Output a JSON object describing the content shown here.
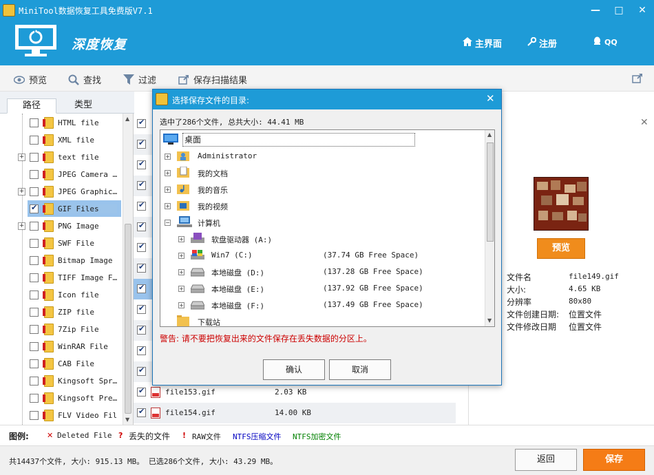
{
  "window": {
    "title": "MiniTool数据恢复工具免费版V7.1",
    "minimize": "—",
    "maximize": "□",
    "close": "✕"
  },
  "header": {
    "app_name": "深度恢复",
    "nav": {
      "home": "主界面",
      "register": "注册",
      "qq": "QQ"
    }
  },
  "toolbar": {
    "preview": "预览",
    "find": "查找",
    "filter": "过滤",
    "save_scan": "保存扫描结果"
  },
  "tabs": {
    "path": "路径",
    "type": "类型"
  },
  "tree": {
    "items": [
      {
        "label": "HTML file",
        "expandable": false
      },
      {
        "label": "XML file",
        "expandable": false
      },
      {
        "label": "text file",
        "expandable": true
      },
      {
        "label": "JPEG Camera …",
        "expandable": false
      },
      {
        "label": "JPEG Graphic…",
        "expandable": true
      },
      {
        "label": "GIF Files",
        "expandable": false,
        "checked": true,
        "selected": true
      },
      {
        "label": "PNG Image",
        "expandable": true
      },
      {
        "label": "SWF File",
        "expandable": false
      },
      {
        "label": "Bitmap Image",
        "expandable": false
      },
      {
        "label": "TIFF Image F…",
        "expandable": false
      },
      {
        "label": "Icon file",
        "expandable": false
      },
      {
        "label": "ZIP file",
        "expandable": false
      },
      {
        "label": "7Zip File",
        "expandable": false
      },
      {
        "label": "WinRAR File",
        "expandable": false
      },
      {
        "label": "CAB File",
        "expandable": false
      },
      {
        "label": "Kingsoft Spr…",
        "expandable": false
      },
      {
        "label": "Kingsoft Pre…",
        "expandable": false
      },
      {
        "label": "FLV Video File",
        "expandable": false
      }
    ]
  },
  "files": {
    "visible": [
      {
        "name": "file153.gif",
        "size": "2.03 KB"
      },
      {
        "name": "file154.gif",
        "size": "14.00 KB"
      }
    ]
  },
  "right_panel": {
    "close": "✕",
    "preview_button": "预览",
    "info": [
      {
        "key": "文件名",
        "value": "file149.gif"
      },
      {
        "key": "大小:",
        "value": "4.65 KB"
      },
      {
        "key": "分辨率",
        "value": "80x80"
      },
      {
        "key": "文件创建日期:",
        "value": "位置文件"
      },
      {
        "key": "文件修改日期",
        "value": "位置文件"
      }
    ]
  },
  "legend": {
    "title": "图例:",
    "deleted": "Deleted File",
    "lost": "丢失的文件",
    "raw": "RAW文件",
    "ntfs_compressed": "NTFS压缩文件",
    "ntfs_encrypted": "NTFS加密文件",
    "colors": {
      "deleted": "#d00000",
      "lost": "#d00000",
      "raw": "#d00000",
      "ntfs_compressed": "#0000c0",
      "ntfs_encrypted": "#008000"
    }
  },
  "status": {
    "text": "共14437个文件, 大小: 915.13 MB。 已选286个文件, 大小: 43.29 MB。",
    "back": "返回",
    "save": "保存"
  },
  "dialog": {
    "title": "选择保存文件的目录:",
    "close": "✕",
    "summary": "选中了286个文件, 总共大小: 44.41 MB",
    "tree": [
      {
        "label": "桌面",
        "icon": "desktop-icon"
      },
      {
        "label": "Administrator",
        "icon": "user-folder-icon"
      },
      {
        "label": "我的文档",
        "icon": "documents-folder-icon"
      },
      {
        "label": "我的音乐",
        "icon": "music-folder-icon"
      },
      {
        "label": "我的视频",
        "icon": "video-folder-icon"
      },
      {
        "label": "计算机",
        "icon": "computer-icon"
      },
      {
        "label": "软盘驱动器 (A:)",
        "icon": "floppy-drive-icon",
        "free": ""
      },
      {
        "label": "Win7 (C:)",
        "icon": "system-drive-icon",
        "free": "(37.74 GB Free Space)"
      },
      {
        "label": "本地磁盘 (D:)",
        "icon": "hard-drive-icon",
        "free": "(137.28 GB Free Space)"
      },
      {
        "label": "本地磁盘 (E:)",
        "icon": "hard-drive-icon",
        "free": "(137.92 GB Free Space)"
      },
      {
        "label": "本地磁盘 (F:)",
        "icon": "hard-drive-icon",
        "free": "(137.49 GB Free Space)"
      },
      {
        "label": "下载站",
        "icon": "folder-icon"
      }
    ],
    "warning": "警告: 请不要把恢复出来的文件保存在丢失数据的分区上。",
    "ok": "确认",
    "cancel": "取消"
  }
}
